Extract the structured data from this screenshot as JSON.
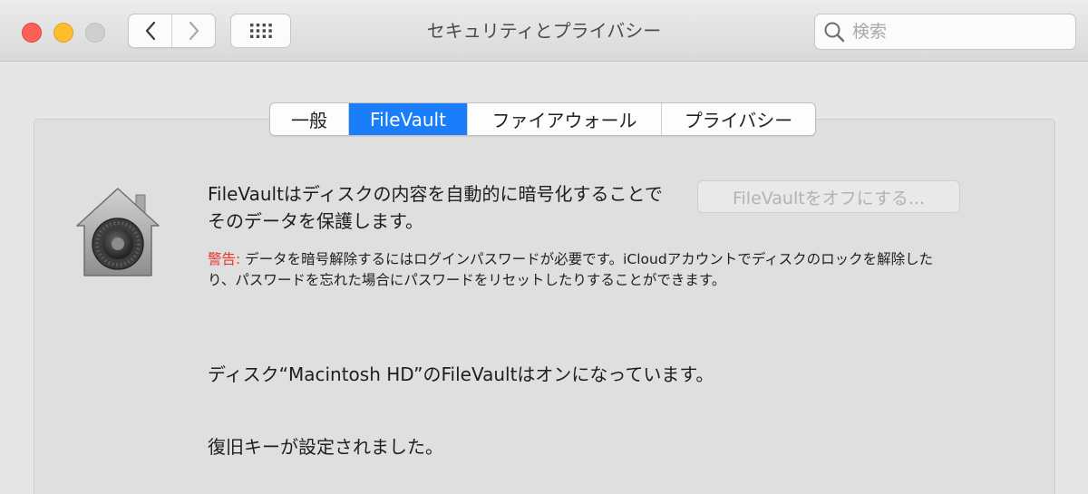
{
  "window": {
    "title": "セキュリティとプライバシー"
  },
  "toolbar": {
    "back_icon": "chevron-left-icon",
    "forward_icon": "chevron-right-icon",
    "grid_icon": "grid-icon",
    "search_placeholder": "検索",
    "search_value": ""
  },
  "tabs": [
    {
      "label": "一般",
      "selected": false
    },
    {
      "label": "FileVault",
      "selected": true
    },
    {
      "label": "ファイアウォール",
      "selected": false
    },
    {
      "label": "プライバシー",
      "selected": false
    }
  ],
  "filevault": {
    "description": "FileVaultはディスクの内容を自動的に暗号化することでそのデータを保護します。",
    "turn_off_button": "FileVaultをオフにする...",
    "warning_label": "警告:",
    "warning_text": " データを暗号解除するにはログインパスワードが必要です。iCloudアカウントでディスクのロックを解除したり、パスワードを忘れた場合にパスワードをリセットしたりすることができます。",
    "status_text": "ディスク“Macintosh HD”のFileVaultはオンになっています。",
    "recovery_text": "復旧キーが設定されました。"
  },
  "colors": {
    "accent": "#1a7efb",
    "warning": "#e8382f",
    "close": "#fe5f57",
    "minimize": "#febc2e"
  }
}
